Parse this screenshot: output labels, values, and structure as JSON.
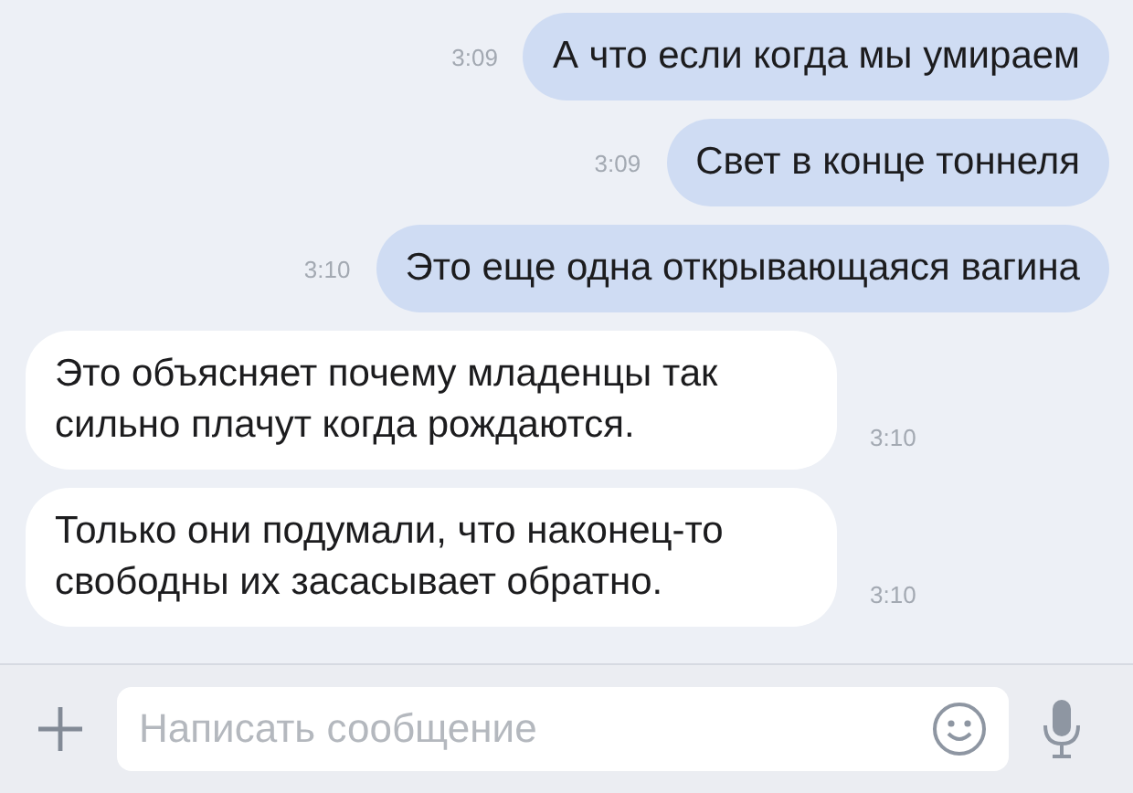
{
  "messages": [
    {
      "kind": "outgoing",
      "text": "А что если когда мы умираем",
      "time": "3:09"
    },
    {
      "kind": "outgoing",
      "text": "Свет в конце тоннеля",
      "time": "3:09"
    },
    {
      "kind": "outgoing",
      "text": "Это еще одна открывающаяся вагина",
      "time": "3:10"
    },
    {
      "kind": "incoming",
      "text": "Это объясняет почему младенцы так сильно плачут когда рождаются.",
      "time": "3:10"
    },
    {
      "kind": "incoming",
      "text": "Только они подумали, что наконец-то свободны их засасывает обратно.",
      "time": "3:10"
    }
  ],
  "composer": {
    "placeholder": "Написать сообщение"
  }
}
